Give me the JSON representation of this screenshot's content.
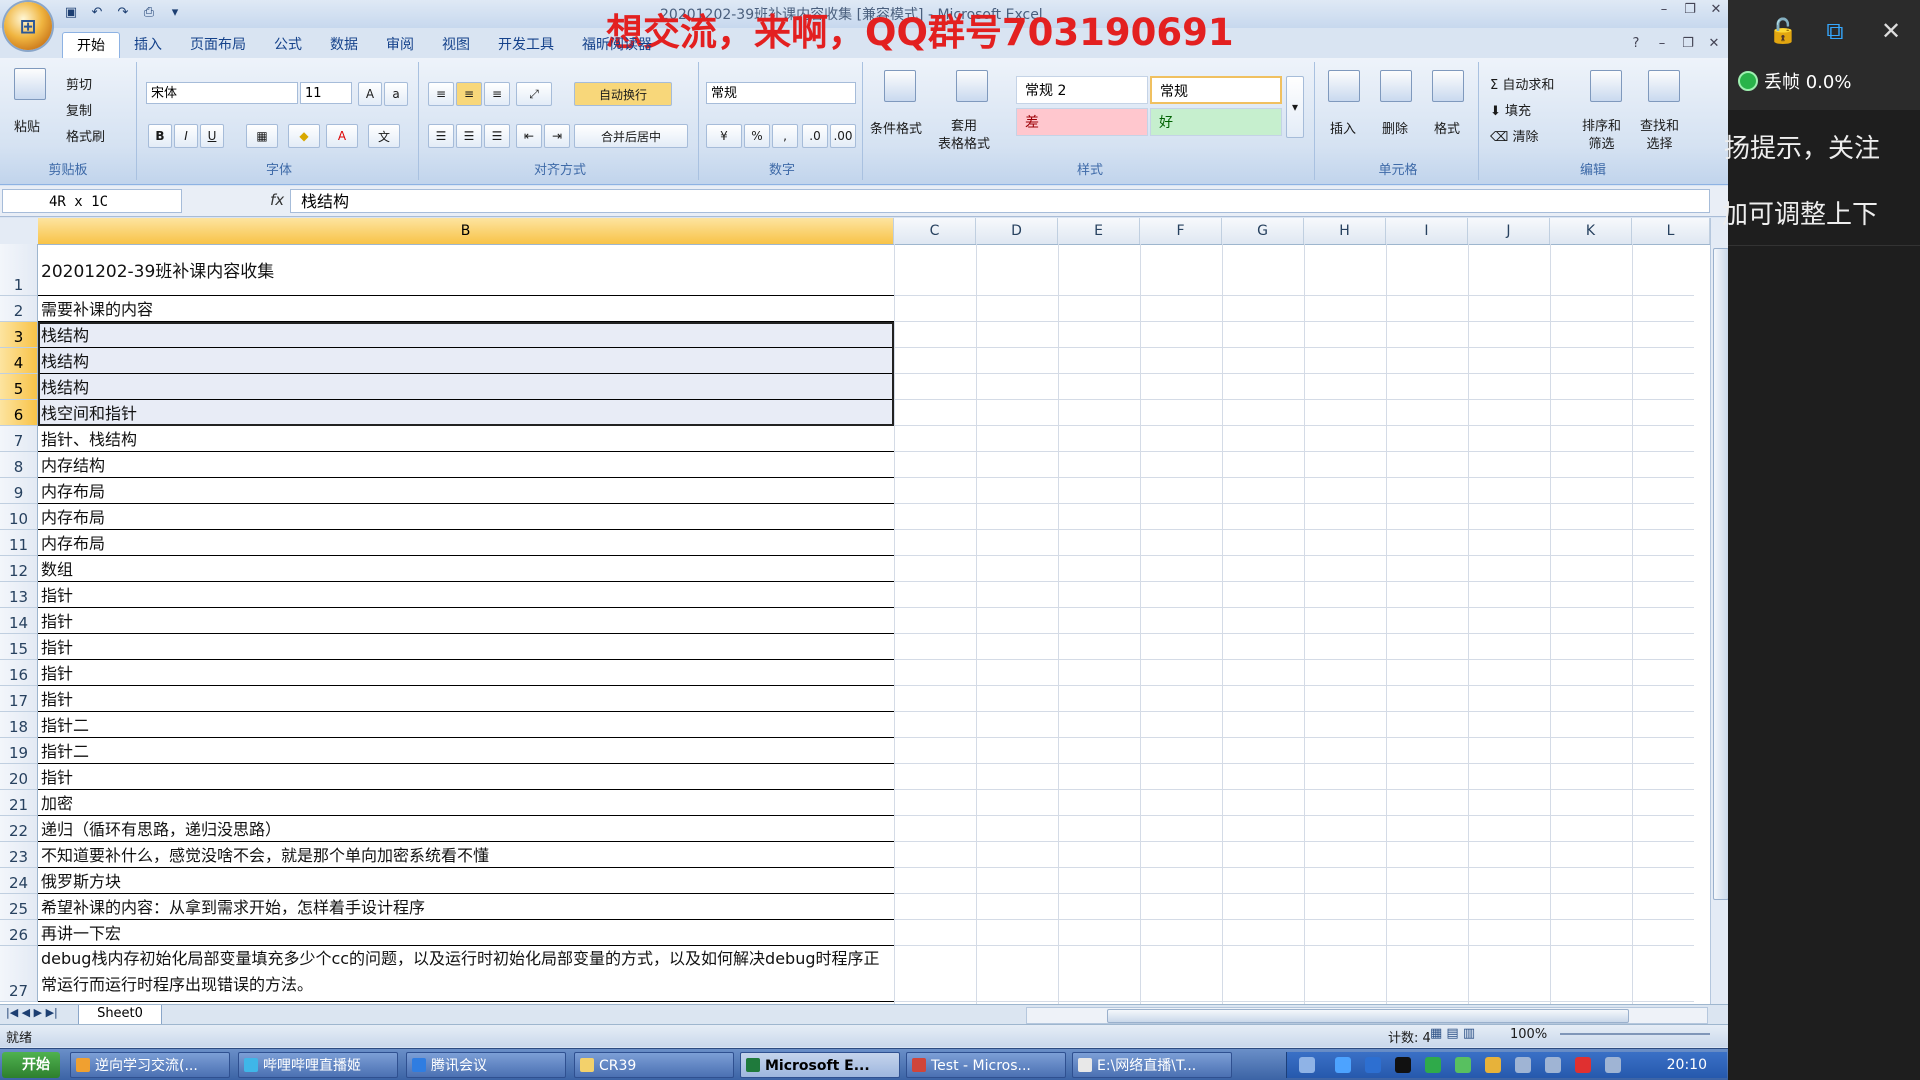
{
  "overlay_banner": "想交流，来啊，QQ群号703190691",
  "window_title_partial": "20201202-39班补课内容收集 [兼容模式] - Microsoft Excel",
  "ribbon": {
    "tabs": [
      "开始",
      "插入",
      "页面布局",
      "公式",
      "数据",
      "审阅",
      "视图",
      "开发工具",
      "福昕阅读器"
    ],
    "active_tab": "开始",
    "clipboard": {
      "paste": "粘贴",
      "cut": "剪切",
      "copy": "复制",
      "format_painter": "格式刷",
      "label": "剪贴板"
    },
    "font": {
      "name": "宋体",
      "size": "11",
      "label": "字体"
    },
    "alignment": {
      "wrap": "自动换行",
      "merge": "合并后居中",
      "label": "对齐方式"
    },
    "number": {
      "format": "常规",
      "label": "数字"
    },
    "styles": {
      "conditional": "条件格式",
      "table": "套用\n表格格式",
      "cells": [
        "常规 2",
        "常规",
        "差",
        "好"
      ],
      "label": "样式"
    },
    "cells_group": {
      "insert": "插入",
      "delete": "删除",
      "format": "格式",
      "label": "单元格"
    },
    "editing": {
      "autosum": "自动求和",
      "fill": "填充",
      "clear": "清除",
      "sort": "排序和\n筛选",
      "find": "查找和\n选择",
      "label": "编辑"
    }
  },
  "formula_bar": {
    "name_box": "4R x 1C",
    "fx": "fx",
    "content": "栈结构"
  },
  "columns": [
    "B",
    "C",
    "D",
    "E",
    "F",
    "G",
    "H",
    "I",
    "J",
    "K",
    "L"
  ],
  "rows": [
    {
      "n": "1",
      "text": "20201202-39班补课内容收集"
    },
    {
      "n": "2",
      "text": "需要补课的内容"
    },
    {
      "n": "3",
      "text": "栈结构"
    },
    {
      "n": "4",
      "text": "栈结构"
    },
    {
      "n": "5",
      "text": "栈结构"
    },
    {
      "n": "6",
      "text": "栈空间和指针"
    },
    {
      "n": "7",
      "text": "指针、栈结构"
    },
    {
      "n": "8",
      "text": "内存结构"
    },
    {
      "n": "9",
      "text": "内存布局"
    },
    {
      "n": "10",
      "text": "内存布局"
    },
    {
      "n": "11",
      "text": "内存布局"
    },
    {
      "n": "12",
      "text": "数组"
    },
    {
      "n": "13",
      "text": "指针"
    },
    {
      "n": "14",
      "text": "指针"
    },
    {
      "n": "15",
      "text": "指针"
    },
    {
      "n": "16",
      "text": "指针"
    },
    {
      "n": "17",
      "text": "指针"
    },
    {
      "n": "18",
      "text": "指针二"
    },
    {
      "n": "19",
      "text": "指针二"
    },
    {
      "n": "20",
      "text": "指针"
    },
    {
      "n": "21",
      "text": "加密"
    },
    {
      "n": "22",
      "text": "递归（循环有思路，递归没思路）"
    },
    {
      "n": "23",
      "text": "不知道要补什么，感觉没啥不会，就是那个单向加密系统看不懂"
    },
    {
      "n": "24",
      "text": "俄罗斯方块"
    },
    {
      "n": "25",
      "text": "希望补课的内容：从拿到需求开始，怎样着手设计程序"
    },
    {
      "n": "26",
      "text": "再讲一下宏"
    },
    {
      "n": "27",
      "text": "debug栈内存初始化局部变量填充多少个cc的问题，以及运行时初始化局部变量的方式，以及如何解决debug时程序正常运行而运行时程序出现错误的方法。"
    }
  ],
  "sheet_tab": "Sheet0",
  "status": {
    "ready": "就绪",
    "count": "计数: 4",
    "zoom": "100%"
  },
  "taskbar": {
    "start": "开始",
    "buttons": [
      "逆向学习交流(...",
      "哔哩哔哩直播姬",
      "腾讯会议",
      "CR39",
      "Microsoft E...",
      "Test - Micros...",
      "E:\\网络直播\\T..."
    ],
    "clock": "20:10"
  },
  "side_panel": {
    "dropframe": "丢帧 0.0%",
    "line1": "扬提示，关注",
    "line2": "加可调整上下"
  },
  "colors": {
    "banner_red": "#e32020",
    "selected_header": "#f8c348",
    "ribbon_blue": "#d5e2f2"
  }
}
